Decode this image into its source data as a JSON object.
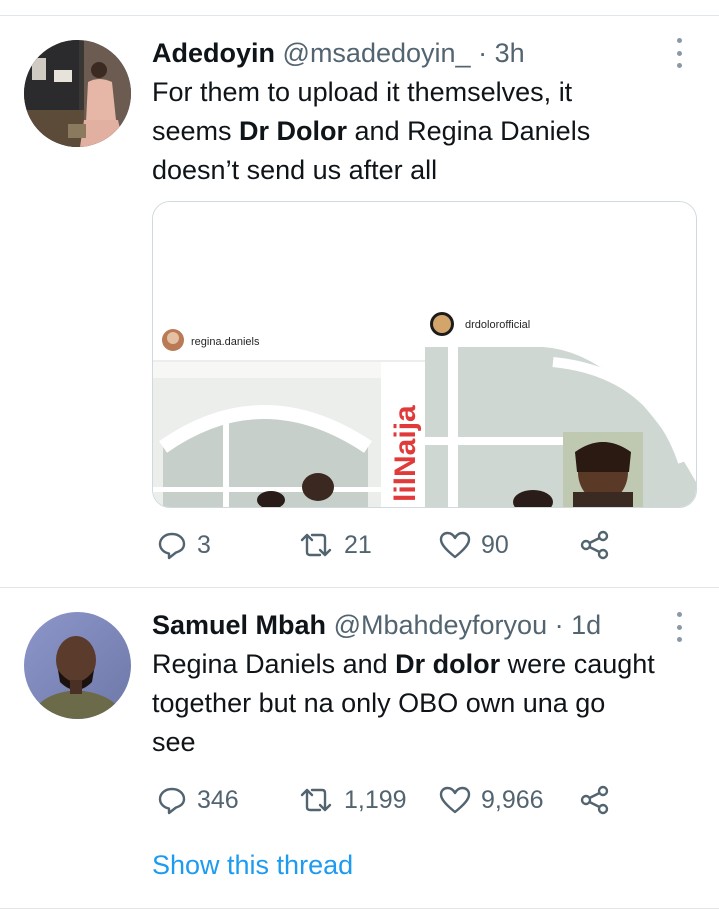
{
  "tweets": [
    {
      "name": "Adedoyin",
      "handle": "@msadedoyin_",
      "separator": "·",
      "time": "3h",
      "text": {
        "l1": "For them to upload it themselves, it",
        "l2_pre": "seems ",
        "l2_bold": "Dr Dolor",
        "l2_post": " and Regina Daniels",
        "l3": "doesn’t send us after all"
      },
      "media": {
        "left_user": "regina.daniels",
        "right_user": "drdolorofficial",
        "watermark": "lilNaija"
      },
      "replies": "3",
      "retweets": "21",
      "likes": "90"
    },
    {
      "name": "Samuel Mbah",
      "handle": "@Mbahdeyforyou",
      "separator": "·",
      "time": "1d",
      "text": {
        "l1_pre": "Regina Daniels and ",
        "l1_bold": "Dr dolor",
        "l1_post": " were caught",
        "l2": "together but na only OBO own una go",
        "l3": "see"
      },
      "replies": "346",
      "retweets": "1,199",
      "likes": "9,966",
      "show_thread": "Show this thread"
    }
  ],
  "colors": {
    "accent": "#1d9bf0",
    "muted": "#536471",
    "text": "#0f1419",
    "divider": "#e1e6ea"
  },
  "icons": [
    "reply-icon",
    "retweet-icon",
    "like-icon",
    "share-icon",
    "more-icon"
  ]
}
